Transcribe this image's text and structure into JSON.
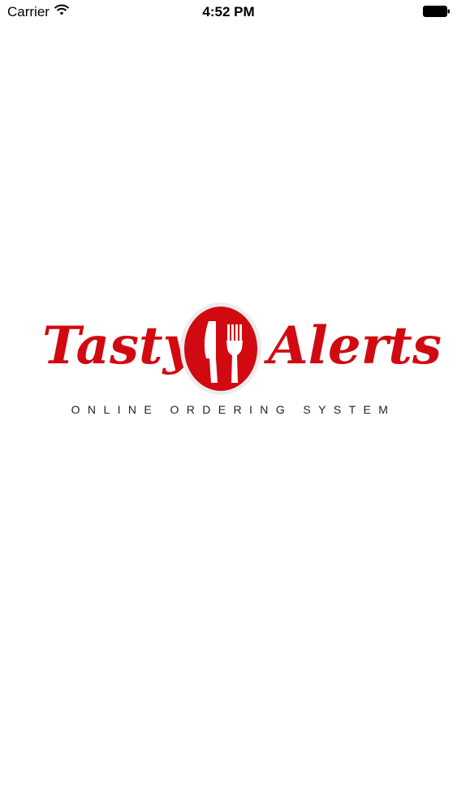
{
  "status_bar": {
    "carrier": "Carrier",
    "time": "4:52 PM",
    "wifi_icon": "wifi-icon",
    "battery_icon": "battery-icon"
  },
  "splash": {
    "brand_word_1": "Tasty",
    "brand_word_2": "Alerts",
    "tagline": "ONLINE ORDERING SYSTEM",
    "logo_icon": "knife-fork-icon",
    "brand_color": "#d10a11"
  }
}
